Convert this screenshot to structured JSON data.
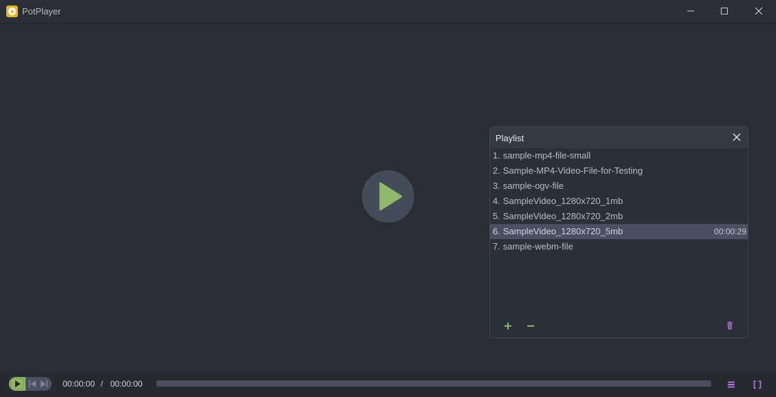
{
  "app": {
    "title": "PotPlayer",
    "logo_color": "#e6b521"
  },
  "window_controls": {
    "minimize_icon": "minimize-icon",
    "maximize_icon": "maximize-icon",
    "close_icon": "close-icon"
  },
  "video": {
    "center_icon": "play-icon",
    "accent": "#8fb86b"
  },
  "playlist": {
    "title": "Playlist",
    "close_icon": "close-icon",
    "items": [
      {
        "num": "1.",
        "name": "sample-mp4-file-small",
        "duration": ""
      },
      {
        "num": "2.",
        "name": "Sample-MP4-Video-File-for-Testing",
        "duration": ""
      },
      {
        "num": "3.",
        "name": "sample-ogv-file",
        "duration": ""
      },
      {
        "num": "4.",
        "name": "SampleVideo_1280x720_1mb",
        "duration": ""
      },
      {
        "num": "5.",
        "name": "SampleVideo_1280x720_2mb",
        "duration": ""
      },
      {
        "num": "6.",
        "name": "SampleVideo_1280x720_5mb",
        "duration": "00:00:29"
      },
      {
        "num": "7.",
        "name": "sample-webm-file",
        "duration": ""
      }
    ],
    "selected_index": 5,
    "footer": {
      "add_icon": "plus-icon",
      "remove_icon": "minus-icon",
      "delete_icon": "trash-icon",
      "add_color": "#8fb86b",
      "delete_color": "#b26fd6"
    }
  },
  "controls": {
    "current_time": "00:00:00",
    "separator": "/",
    "total_time": "00:00:00",
    "progress": 0,
    "playlist_toggle_icon": "playlist-icon",
    "fullscreen_icon": "fullscreen-icon",
    "accent_purple": "#b26fd6"
  }
}
